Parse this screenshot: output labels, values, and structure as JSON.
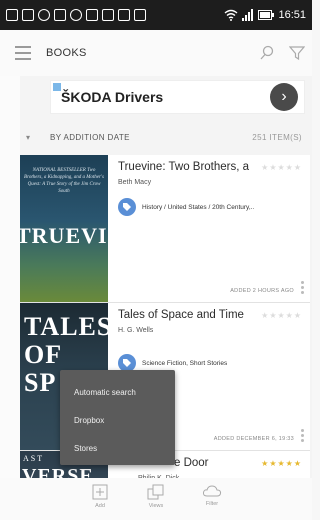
{
  "statusbar": {
    "time": "16:51"
  },
  "header": {
    "title": "BOOKS"
  },
  "ad": {
    "text": "ŠKODA Drivers"
  },
  "sort": {
    "label": "BY ADDITION DATE",
    "count": "251 ITEM(S)"
  },
  "books": [
    {
      "cover_big": "TRUEVIN",
      "cover_small": "NATIONAL BESTSELLER Two Brothers, a Kidnapping, and a Mother's Quest: A True Story of the Jim Crow South",
      "title": "Truevine: Two Brothers, a",
      "author": "Beth Macy",
      "tag": "History / United States / 20th Century,..",
      "added": "ADDED 2 HOURS AGO",
      "stars": "★★★★★"
    },
    {
      "cover_big": "TALES OF SP",
      "title": "Tales of Space and Time",
      "author": "H. G. Wells",
      "tag": "Science Fiction, Short Stories",
      "added": "ADDED DECEMBER 6, 19:33",
      "stars": "★★★★★"
    },
    {
      "cover_big": "VERSE",
      "cover_small": "AST",
      "title": "e Door",
      "author": "Philip K. Dick",
      "stars": "★★★★★"
    }
  ],
  "popup": {
    "items": [
      "Automatic search",
      "Dropbox",
      "Stores"
    ]
  },
  "bottom_tabs": [
    {
      "label": "Add",
      "icon": "add-icon"
    },
    {
      "label": "Views",
      "icon": "views-icon"
    },
    {
      "label": "Filter",
      "icon": "cloud-icon"
    }
  ]
}
